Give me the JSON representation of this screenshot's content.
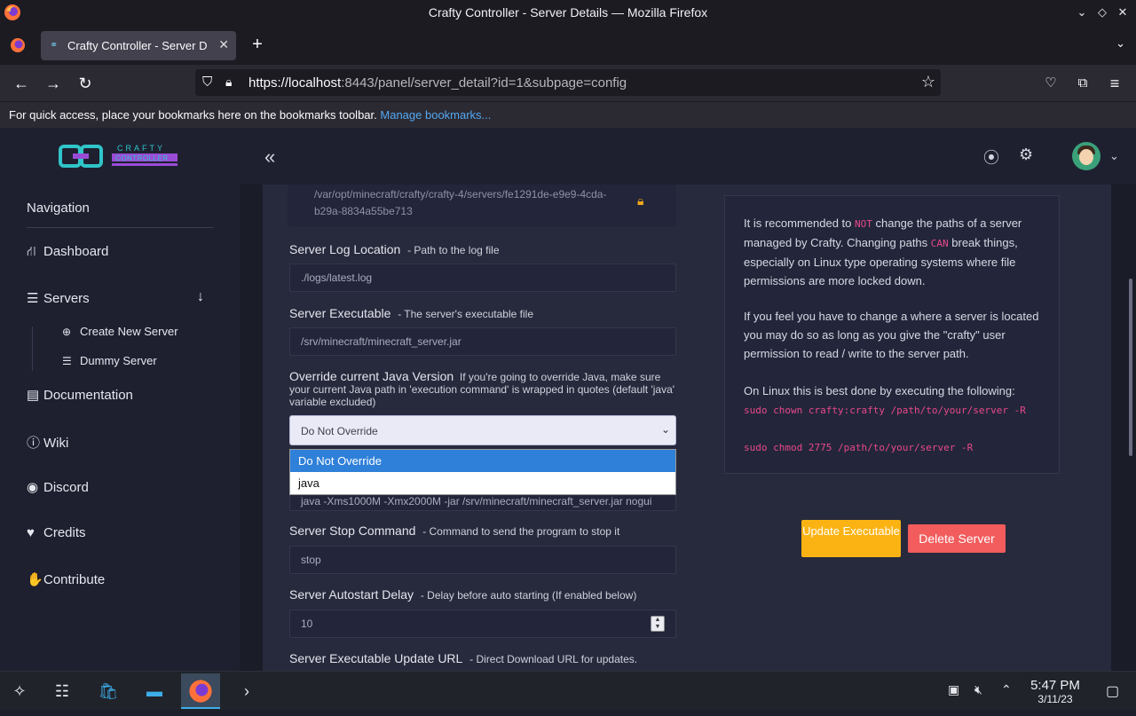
{
  "window": {
    "title": "Crafty Controller - Server Details — Mozilla Firefox"
  },
  "tab": {
    "label": "Crafty Controller - Server D",
    "close": "✕",
    "new_tab": "+"
  },
  "navbar": {
    "url_host": "https://localhost",
    "url_rest": ":8443/panel/server_detail?id=1&subpage=config"
  },
  "bookmarks": {
    "message": "For quick access, place your bookmarks here on the bookmarks toolbar.",
    "link": "Manage bookmarks..."
  },
  "sidebar": {
    "heading": "Navigation",
    "items": [
      {
        "label": "Dashboard",
        "icon": "sitemap-icon"
      },
      {
        "label": "Servers",
        "icon": "server-icon"
      },
      {
        "label": "Documentation",
        "icon": "book-icon"
      },
      {
        "label": "Wiki",
        "icon": "info-icon"
      },
      {
        "label": "Discord",
        "icon": "discord-icon"
      },
      {
        "label": "Credits",
        "icon": "heart-icon"
      },
      {
        "label": "Contribute",
        "icon": "hand-icon"
      }
    ],
    "sub_items": [
      {
        "label": "Create New Server"
      },
      {
        "label": "Dummy Server"
      }
    ]
  },
  "form": {
    "server_path": "/var/opt/minecraft/crafty/crafty-4/servers/fe1291de-e9e9-4cda-b29a-8834a55be713",
    "log_location": {
      "label": "Server Log Location",
      "hint": "- Path to the log file",
      "value": "./logs/latest.log"
    },
    "executable": {
      "label": "Server Executable",
      "hint": "- The server's executable file",
      "value": "/srv/minecraft/minecraft_server.jar"
    },
    "java": {
      "label": "Override current Java Version",
      "hint": "If you're going to override Java, make sure your current Java path in 'execution command' is wrapped in quotes (default 'java' variable excluded)",
      "selected": "Do Not Override",
      "options": [
        "Do Not Override",
        "java"
      ]
    },
    "exec_command": {
      "value": "java -Xms1000M -Xmx2000M -jar /srv/minecraft/minecraft_server.jar nogui"
    },
    "stop_command": {
      "label": "Server Stop Command",
      "hint": "- Command to send the program to stop it",
      "value": "stop"
    },
    "autostart_delay": {
      "label": "Server Autostart Delay",
      "hint": "- Delay before auto starting (If enabled below)",
      "value": "10"
    },
    "update_url": {
      "label": "Server Executable Update URL",
      "hint": "- Direct Download URL for updates."
    }
  },
  "info": {
    "p1_a": "It is recommended to ",
    "p1_not": "NOT",
    "p1_b": " change the paths of a server managed by Crafty. Changing paths ",
    "p1_can": "CAN",
    "p1_c": " break things, especially on Linux type operating systems where file permissions are more locked down.",
    "p2": "If you feel you have to change a where a server is located you may do so as long as you give the \"crafty\" user permission to read / write to the server path.",
    "p3": "On Linux this is best done by executing the following:",
    "cmd1": "sudo chown crafty:crafty /path/to/your/server -R",
    "cmd2": "sudo chmod 2775 /path/to/your/server -R"
  },
  "buttons": {
    "update": "Update Executable",
    "delete": "Delete Server"
  },
  "taskbar": {
    "time": "5:47 PM",
    "date": "3/11/23"
  },
  "colors": {
    "accent_yellow": "#fbb314",
    "accent_red": "#f25c5c",
    "selected_blue": "#2f80d9",
    "code_pink": "#e8488a"
  }
}
